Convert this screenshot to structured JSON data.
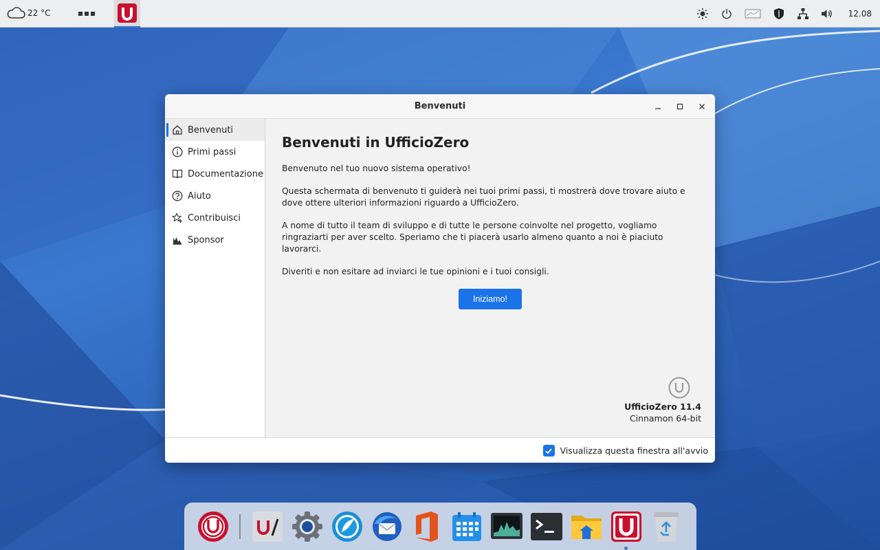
{
  "panel": {
    "weather_text": "22 °C",
    "weather_icon": "cloud-icon",
    "menu_icon": "apps-menu-icon",
    "active_app_icon": "ufficiozero-icon",
    "tray_icons": [
      "brightness-icon",
      "power-icon",
      "display-icon",
      "shield-icon",
      "network-icon",
      "volume-icon"
    ],
    "clock": "12.08"
  },
  "window": {
    "title": "Benvenuti",
    "controls": [
      "minimize-icon",
      "maximize-icon",
      "close-icon"
    ],
    "sidebar": {
      "items": [
        {
          "label": "Benvenuti",
          "icon": "home-icon",
          "active": true
        },
        {
          "label": "Primi passi",
          "icon": "info-icon"
        },
        {
          "label": "Documentazione",
          "icon": "book-icon"
        },
        {
          "label": "Aiuto",
          "icon": "help-icon"
        },
        {
          "label": "Contribuisci",
          "icon": "star-icon"
        },
        {
          "label": "Sponsor",
          "icon": "chart-icon"
        }
      ]
    },
    "content": {
      "heading": "Benvenuti in UfficioZero",
      "paragraphs": [
        "Benvenuto nel tuo nuovo sistema operativo!",
        "Questa schermata di benvenuto ti guiderà nei tuoi primi passi, ti mostrerà dove trovare aiuto e dove ottere ulteriori informazioni riguardo a UfficioZero.",
        "A nome di tutto il team di sviluppo e di tutte le persone coinvolte nel progetto, vogliamo ringraziarti per aver scelto. Speriamo che ti piacerà usarlo almeno quanto a noi è piaciuto lavorarci.",
        "Diveriti e non esitare ad inviarci le tue opinioni e i tuoi consigli."
      ],
      "cta_label": "Iniziamo!",
      "brand_name": "UfficioZero 11.4",
      "brand_sub": "Cinnamon 64-bit"
    },
    "footer": {
      "startup_checkbox_label": "Visualizza questa finestra all'avvio",
      "startup_checked": true
    }
  },
  "dock": {
    "items": [
      "ufficiozero-menu-icon",
      "separator",
      "text-editor-icon",
      "settings-icon",
      "browser-icon",
      "mail-icon",
      "office-icon",
      "calendar-icon",
      "system-monitor-icon",
      "terminal-icon",
      "files-icon",
      "ufficiozero-welcome-icon",
      "trash-icon"
    ]
  },
  "colors": {
    "accent": "#1a73e8",
    "brand_red": "#c8102e",
    "wallpaper": "#2e66bb"
  }
}
